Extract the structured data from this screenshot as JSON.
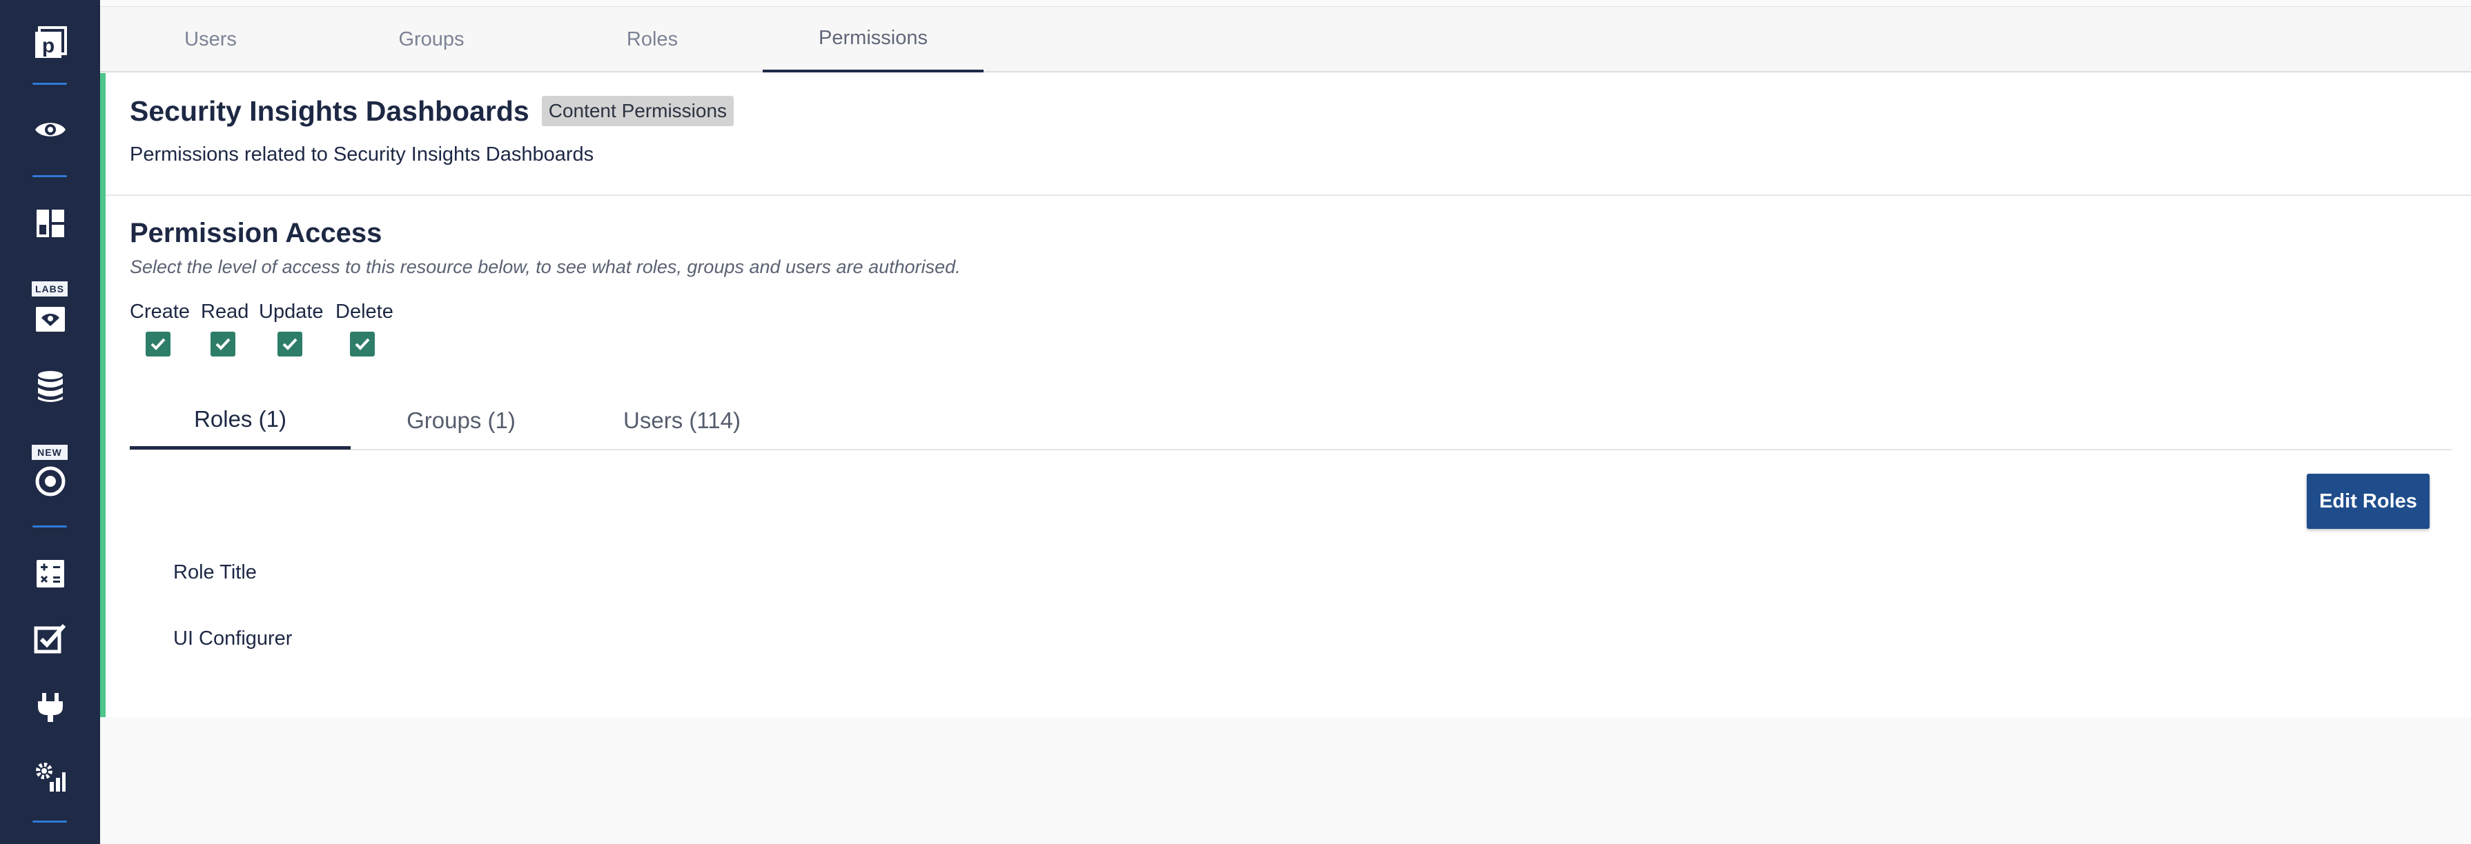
{
  "sidebar": {
    "icons": [
      "logo-p-icon",
      "eye-icon",
      "dashboard-icon",
      "labs-vision-icon",
      "database-icon",
      "target-icon",
      "calculator-icon",
      "checkbox-edit-icon",
      "plug-icon",
      "settings-chart-icon"
    ],
    "labs_badge": "LABS",
    "new_badge": "NEW",
    "accent_color": "#2f7ad7"
  },
  "topnav": {
    "tabs": [
      {
        "label": "Users"
      },
      {
        "label": "Groups"
      },
      {
        "label": "Roles"
      },
      {
        "label": "Permissions"
      }
    ],
    "active": "Permissions"
  },
  "resource": {
    "title": "Security Insights Dashboards",
    "badge": "Content Permissions",
    "description": "Permissions related to Security Insights Dashboards"
  },
  "access": {
    "title": "Permission Access",
    "subtitle": "Select the level of access to this resource below, to see what roles, groups and users are authorised.",
    "permissions": [
      {
        "label": "Create",
        "checked": true
      },
      {
        "label": "Read",
        "checked": true
      },
      {
        "label": "Update",
        "checked": true
      },
      {
        "label": "Delete",
        "checked": true
      }
    ]
  },
  "subtabs": [
    {
      "label": "Roles (1)"
    },
    {
      "label": "Groups (1)"
    },
    {
      "label": "Users (114)"
    }
  ],
  "roles": {
    "edit_button": "Edit Roles",
    "column_header": "Role Title",
    "rows": [
      "UI Configurer"
    ]
  },
  "colors": {
    "sidebar_bg": "#1f2a47",
    "checkbox": "#2e7d68",
    "button": "#1f4d8c",
    "accent_bar": "#4cc68a"
  }
}
